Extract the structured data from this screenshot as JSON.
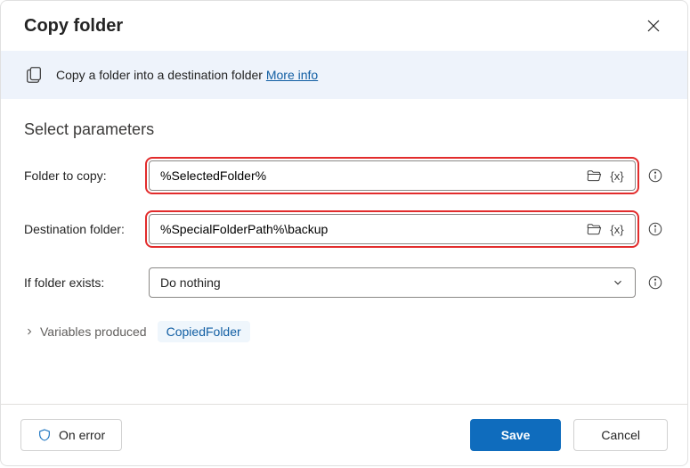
{
  "header": {
    "title": "Copy folder"
  },
  "banner": {
    "text": "Copy a folder into a destination folder",
    "more_info": "More info"
  },
  "section_title": "Select parameters",
  "params": {
    "folder_to_copy": {
      "label": "Folder to copy:",
      "value": "%SelectedFolder%"
    },
    "destination_folder": {
      "label": "Destination folder:",
      "value": "%SpecialFolderPath%\\backup"
    },
    "if_exists": {
      "label": "If folder exists:",
      "value": "Do nothing"
    }
  },
  "variables": {
    "label": "Variables produced",
    "chip": "CopiedFolder"
  },
  "footer": {
    "on_error": "On error",
    "save": "Save",
    "cancel": "Cancel"
  }
}
